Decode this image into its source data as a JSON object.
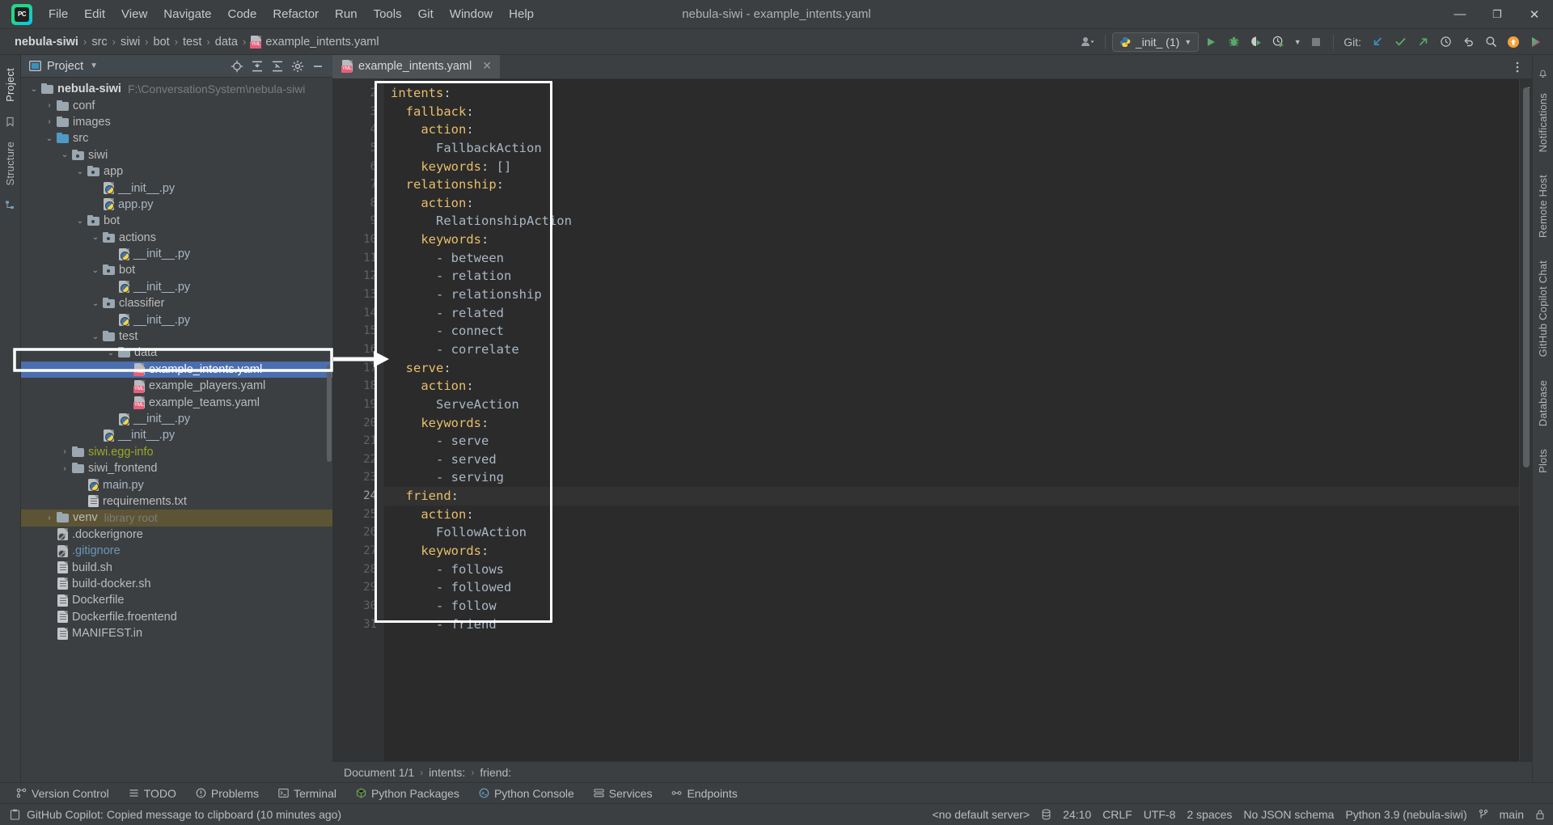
{
  "window": {
    "title": "nebula-siwi - example_intents.yaml",
    "minimize": "—",
    "maximize": "❐",
    "close": "✕"
  },
  "menu": {
    "items": [
      {
        "label": "File"
      },
      {
        "label": "Edit"
      },
      {
        "label": "View"
      },
      {
        "label": "Navigate"
      },
      {
        "label": "Code"
      },
      {
        "label": "Refactor"
      },
      {
        "label": "Run"
      },
      {
        "label": "Tools"
      },
      {
        "label": "Git"
      },
      {
        "label": "Window"
      },
      {
        "label": "Help"
      }
    ]
  },
  "navbar": {
    "breadcrumbs": [
      "nebula-siwi",
      "src",
      "siwi",
      "bot",
      "test",
      "data",
      "example_intents.yaml"
    ],
    "separator": "›",
    "run_config": "_init_  (1)",
    "git_label": "Git:"
  },
  "project_panel": {
    "title": "Project",
    "tree": [
      {
        "indent": 0,
        "arrow": "v",
        "icon": "folder",
        "label": "nebula-siwi",
        "sub": "F:\\ConversationSystem\\nebula-siwi",
        "bold": true
      },
      {
        "indent": 1,
        "arrow": ">",
        "icon": "folder",
        "label": "conf"
      },
      {
        "indent": 1,
        "arrow": ">",
        "icon": "folder",
        "label": "images"
      },
      {
        "indent": 1,
        "arrow": "v",
        "icon": "folder-src",
        "label": "src"
      },
      {
        "indent": 2,
        "arrow": "v",
        "icon": "folder-pkg",
        "label": "siwi"
      },
      {
        "indent": 3,
        "arrow": "v",
        "icon": "folder-pkg",
        "label": "app"
      },
      {
        "indent": 4,
        "arrow": "",
        "icon": "python-file",
        "label": "__init__.py"
      },
      {
        "indent": 4,
        "arrow": "",
        "icon": "python-file",
        "label": "app.py"
      },
      {
        "indent": 3,
        "arrow": "v",
        "icon": "folder-pkg",
        "label": "bot"
      },
      {
        "indent": 4,
        "arrow": "v",
        "icon": "folder-pkg",
        "label": "actions"
      },
      {
        "indent": 5,
        "arrow": "",
        "icon": "python-file",
        "label": "__init__.py"
      },
      {
        "indent": 4,
        "arrow": "v",
        "icon": "folder-pkg",
        "label": "bot"
      },
      {
        "indent": 5,
        "arrow": "",
        "icon": "python-file",
        "label": "__init__.py"
      },
      {
        "indent": 4,
        "arrow": "v",
        "icon": "folder-pkg",
        "label": "classifier"
      },
      {
        "indent": 5,
        "arrow": "",
        "icon": "python-file",
        "label": "__init__.py"
      },
      {
        "indent": 4,
        "arrow": "v",
        "icon": "folder",
        "label": "test"
      },
      {
        "indent": 5,
        "arrow": "v",
        "icon": "folder",
        "label": "data"
      },
      {
        "indent": 6,
        "arrow": "",
        "icon": "yaml-file",
        "label": "example_intents.yaml",
        "selected": true
      },
      {
        "indent": 6,
        "arrow": "",
        "icon": "yaml-file",
        "label": "example_players.yaml"
      },
      {
        "indent": 6,
        "arrow": "",
        "icon": "yaml-file",
        "label": "example_teams.yaml"
      },
      {
        "indent": 5,
        "arrow": "",
        "icon": "python-file",
        "label": "__init__.py"
      },
      {
        "indent": 4,
        "arrow": "",
        "icon": "python-file",
        "label": "__init__.py"
      },
      {
        "indent": 2,
        "arrow": ">",
        "icon": "folder",
        "label": "siwi.egg-info",
        "color": "yellowdir"
      },
      {
        "indent": 2,
        "arrow": ">",
        "icon": "folder",
        "label": "siwi_frontend"
      },
      {
        "indent": 3,
        "arrow": "",
        "icon": "python-file",
        "label": "main.py"
      },
      {
        "indent": 3,
        "arrow": "",
        "icon": "text-file",
        "label": "requirements.txt"
      },
      {
        "indent": 1,
        "arrow": ">",
        "icon": "folder",
        "label": "venv",
        "sub": "library root",
        "venv": true
      },
      {
        "indent": 1,
        "arrow": "",
        "icon": "ignore-file",
        "label": ".dockerignore"
      },
      {
        "indent": 1,
        "arrow": "",
        "icon": "ignore-file",
        "label": ".gitignore",
        "color": "ign"
      },
      {
        "indent": 1,
        "arrow": "",
        "icon": "sh-file",
        "label": "build.sh"
      },
      {
        "indent": 1,
        "arrow": "",
        "icon": "sh-file",
        "label": "build-docker.sh"
      },
      {
        "indent": 1,
        "arrow": "",
        "icon": "docker-file",
        "label": "Dockerfile"
      },
      {
        "indent": 1,
        "arrow": "",
        "icon": "docker-file",
        "label": "Dockerfile.froentend"
      },
      {
        "indent": 1,
        "arrow": "",
        "icon": "text-file",
        "label": "MANIFEST.in"
      }
    ]
  },
  "editor": {
    "tab": {
      "label": "example_intents.yaml",
      "close": "✕"
    },
    "first_line_number": 2,
    "current_line": 24,
    "lines": [
      {
        "n": 2,
        "indent": 0,
        "key": "intents",
        "colon": ":",
        "fold": true
      },
      {
        "n": 3,
        "indent": 1,
        "key": "fallback",
        "colon": ":",
        "fold": true
      },
      {
        "n": 4,
        "indent": 2,
        "key": "action",
        "colon": ":"
      },
      {
        "n": 5,
        "indent": 3,
        "value": "FallbackAction"
      },
      {
        "n": 6,
        "indent": 2,
        "key": "keywords",
        "colon": ":",
        "value": " []",
        "fold": true
      },
      {
        "n": 7,
        "indent": 1,
        "key": "relationship",
        "colon": ":",
        "fold": true
      },
      {
        "n": 8,
        "indent": 2,
        "key": "action",
        "colon": ":"
      },
      {
        "n": 9,
        "indent": 3,
        "value": "RelationshipAction"
      },
      {
        "n": 10,
        "indent": 2,
        "key": "keywords",
        "colon": ":",
        "fold": true
      },
      {
        "n": 11,
        "indent": 3,
        "value": "- between"
      },
      {
        "n": 12,
        "indent": 3,
        "value": "- relation"
      },
      {
        "n": 13,
        "indent": 3,
        "value": "- relationship"
      },
      {
        "n": 14,
        "indent": 3,
        "value": "- related"
      },
      {
        "n": 15,
        "indent": 3,
        "value": "- connect"
      },
      {
        "n": 16,
        "indent": 3,
        "value": "- correlate"
      },
      {
        "n": 17,
        "indent": 1,
        "key": "serve",
        "colon": ":",
        "fold": true
      },
      {
        "n": 18,
        "indent": 2,
        "key": "action",
        "colon": ":"
      },
      {
        "n": 19,
        "indent": 3,
        "value": "ServeAction"
      },
      {
        "n": 20,
        "indent": 2,
        "key": "keywords",
        "colon": ":",
        "fold": true
      },
      {
        "n": 21,
        "indent": 3,
        "value": "- serve"
      },
      {
        "n": 22,
        "indent": 3,
        "value": "- served"
      },
      {
        "n": 23,
        "indent": 3,
        "value": "- serving"
      },
      {
        "n": 24,
        "indent": 1,
        "key": "friend",
        "colon": ":",
        "fold": true,
        "current": true
      },
      {
        "n": 25,
        "indent": 2,
        "key": "action",
        "colon": ":"
      },
      {
        "n": 26,
        "indent": 3,
        "value": "FollowAction"
      },
      {
        "n": 27,
        "indent": 2,
        "key": "keywords",
        "colon": ":",
        "fold": true
      },
      {
        "n": 28,
        "indent": 3,
        "value": "- follows"
      },
      {
        "n": 29,
        "indent": 3,
        "value": "- followed"
      },
      {
        "n": 30,
        "indent": 3,
        "value": "- follow"
      },
      {
        "n": 31,
        "indent": 3,
        "value": "- friend"
      }
    ],
    "breadcrumbs": [
      "Document 1/1",
      "intents:",
      "friend:"
    ],
    "breadcrumb_separator": "›"
  },
  "tool_windows": {
    "left_tabs": [
      "Project",
      "Structure"
    ],
    "right_tabs": [
      "Notifications",
      "Remote Host",
      "GitHub Copilot Chat",
      "Database",
      "Plots"
    ],
    "bottom": [
      {
        "label": "Version Control",
        "icon": "branch-icon"
      },
      {
        "label": "TODO",
        "icon": "list-icon"
      },
      {
        "label": "Problems",
        "icon": "warning-icon"
      },
      {
        "label": "Terminal",
        "icon": "terminal-icon"
      },
      {
        "label": "Python Packages",
        "icon": "package-icon"
      },
      {
        "label": "Python Console",
        "icon": "console-icon"
      },
      {
        "label": "Services",
        "icon": "services-icon"
      },
      {
        "label": "Endpoints",
        "icon": "endpoints-icon"
      }
    ]
  },
  "statusbar": {
    "message": "GitHub Copilot: Copied message to clipboard (10 minutes ago)",
    "server": "<no default server>",
    "caret": "24:10",
    "line_separator": "CRLF",
    "encoding": "UTF-8",
    "indent": "2 spaces",
    "schema": "No JSON schema",
    "interpreter": "Python 3.9 (nebula-siwi)",
    "branch": "main"
  },
  "colors": {
    "accent": "#4b6eaf",
    "bg": "#3c3f41",
    "editor_bg": "#2b2b2b",
    "yaml_key": "#e8bf6a",
    "text": "#a9b7c6",
    "highlight_border": "#ffffff",
    "venv_bg": "#5c5434"
  }
}
